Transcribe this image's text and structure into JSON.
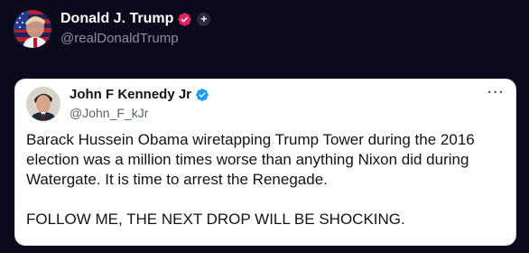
{
  "post": {
    "author": {
      "name": "Donald J. Trump",
      "handle": "@realDonaldTrump",
      "avatar_icon": "flag-portrait-avatar",
      "badge_icon": "verified-badge-icon",
      "badge_color": "#e0245e",
      "follow_icon": "plus-icon",
      "follow_symbol": "+"
    }
  },
  "quoted": {
    "author": {
      "name": "John F Kennedy Jr",
      "handle": "@John_F_kJr",
      "badge_icon": "verified-badge-icon",
      "badge_color": "#1d9bf0"
    },
    "more_label": "···",
    "text": {
      "line1": "Barack Hussein Obama wiretapping Trump Tower during the 2016 election was a million times worse than anything Nixon did during Watergate. It is time to arrest the Renegade.",
      "line2": "FOLLOW ME, THE NEXT DROP WILL BE SHOCKING."
    }
  },
  "colors": {
    "background": "#0b0a1c",
    "card": "#ffffff",
    "text_primary": "#0f1419",
    "text_secondary": "#536471"
  }
}
